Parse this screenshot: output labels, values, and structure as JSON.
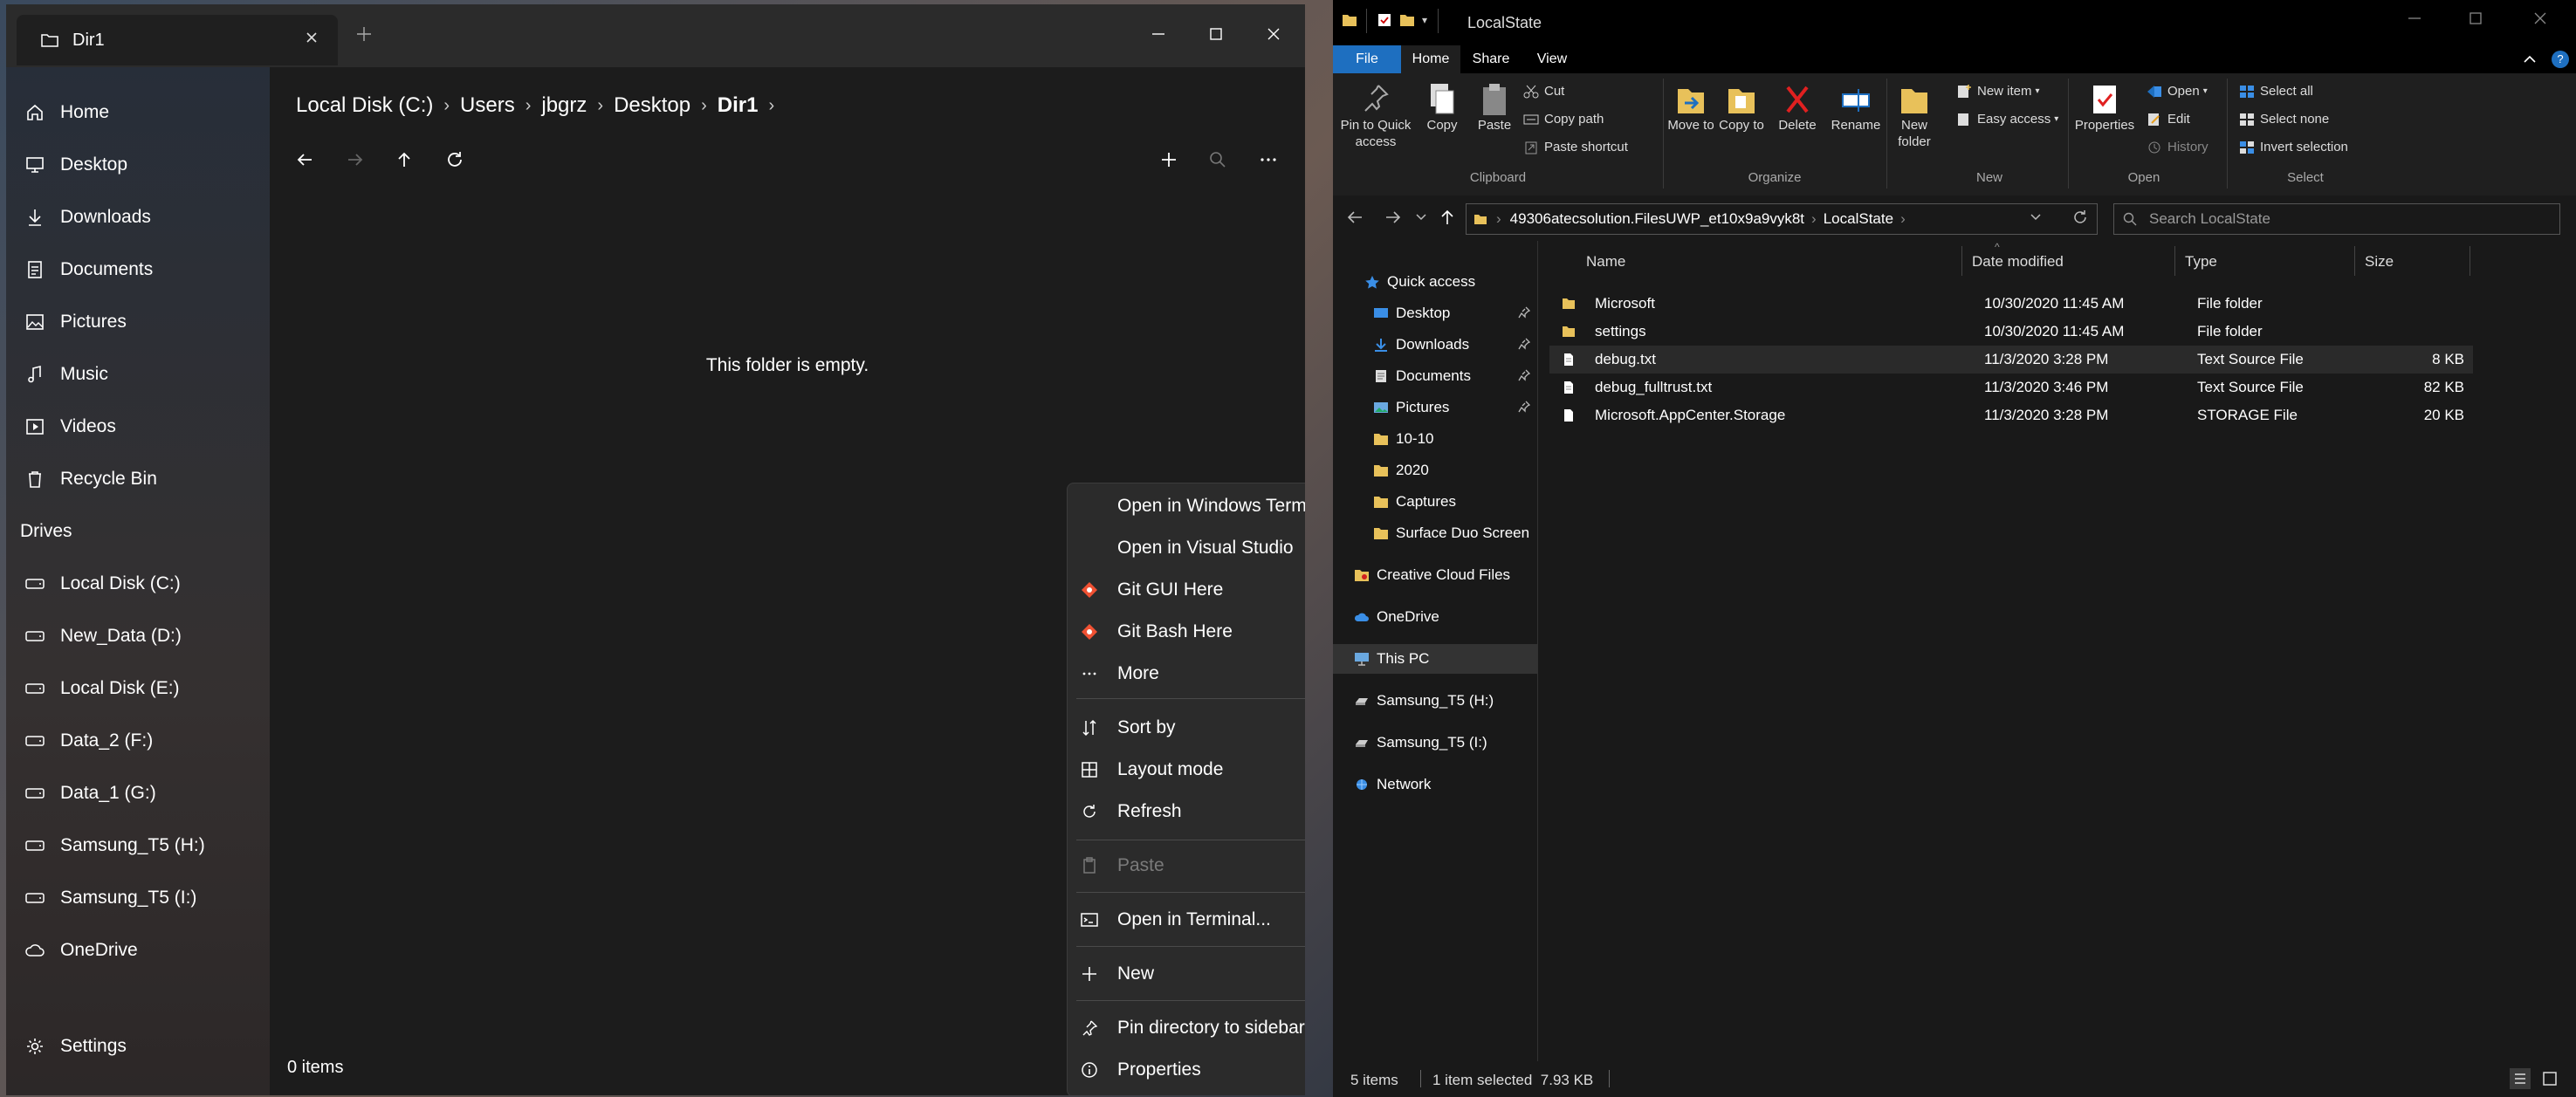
{
  "files_app": {
    "tab_title": "Dir1",
    "sidebar": {
      "items": [
        {
          "label": "Home",
          "icon": "home-icon"
        },
        {
          "label": "Desktop",
          "icon": "desktop-icon"
        },
        {
          "label": "Downloads",
          "icon": "download-icon"
        },
        {
          "label": "Documents",
          "icon": "document-icon"
        },
        {
          "label": "Pictures",
          "icon": "picture-icon"
        },
        {
          "label": "Music",
          "icon": "music-icon"
        },
        {
          "label": "Videos",
          "icon": "video-icon"
        },
        {
          "label": "Recycle Bin",
          "icon": "recycle-bin-icon"
        }
      ],
      "drives_header": "Drives",
      "drives": [
        {
          "label": "Local Disk (C:)"
        },
        {
          "label": "New_Data (D:)"
        },
        {
          "label": "Local Disk (E:)"
        },
        {
          "label": "Data_2 (F:)"
        },
        {
          "label": "Data_1 (G:)"
        },
        {
          "label": "Samsung_T5 (H:)"
        },
        {
          "label": "Samsung_T5 (I:)"
        },
        {
          "label": "OneDrive"
        }
      ],
      "settings": "Settings"
    },
    "breadcrumb": [
      "Local Disk (C:)",
      "Users",
      "jbgrz",
      "Desktop",
      "Dir1"
    ],
    "empty_message": "This folder is empty.",
    "status": "0 items",
    "context_menu": {
      "items": [
        {
          "label": "Open in Windows Terminal"
        },
        {
          "label": "Open in Visual Studio"
        },
        {
          "label": "Git GUI Here",
          "icon": "git-icon"
        },
        {
          "label": "Git Bash Here",
          "icon": "git-icon"
        },
        {
          "label": "More",
          "icon": "more-icon"
        },
        {
          "label": "Sort by",
          "icon": "sort-icon"
        },
        {
          "label": "Layout mode",
          "icon": "layout-icon"
        },
        {
          "label": "Refresh",
          "icon": "refresh-icon"
        },
        {
          "label": "Paste",
          "icon": "paste-icon",
          "disabled": true
        },
        {
          "label": "Open in Terminal...",
          "icon": "terminal-icon"
        },
        {
          "label": "New",
          "icon": "plus-icon"
        },
        {
          "label": "Pin directory to sidebar",
          "icon": "pin-icon"
        },
        {
          "label": "Properties",
          "icon": "info-icon"
        }
      ]
    }
  },
  "explorer": {
    "title": "LocalState",
    "ribbon_tabs": [
      "File",
      "Home",
      "Share",
      "View"
    ],
    "ribbon": {
      "pin_quick_access": "Pin to Quick access",
      "copy": "Copy",
      "paste": "Paste",
      "cut": "Cut",
      "copy_path": "Copy path",
      "paste_shortcut": "Paste shortcut",
      "move_to": "Move to",
      "copy_to": "Copy to",
      "delete": "Delete",
      "rename": "Rename",
      "new_folder": "New folder",
      "new_item": "New item",
      "easy_access": "Easy access",
      "properties": "Properties",
      "open": "Open",
      "edit": "Edit",
      "history": "History",
      "select_all": "Select all",
      "select_none": "Select none",
      "invert_selection": "Invert selection",
      "groups": [
        "Clipboard",
        "Organize",
        "New",
        "Open",
        "Select"
      ]
    },
    "address": [
      "49306atecsolution.FilesUWP_et10x9a9vyk8t",
      "LocalState"
    ],
    "search_placeholder": "Search LocalState",
    "nav": {
      "quick_access": "Quick access",
      "pinned": [
        "Desktop",
        "Downloads",
        "Documents",
        "Pictures"
      ],
      "folders": [
        "10-10",
        "2020",
        "Captures",
        "Surface Duo Screen"
      ],
      "creative_cloud": "Creative Cloud Files",
      "onedrive": "OneDrive",
      "this_pc": "This PC",
      "drives": [
        "Samsung_T5 (H:)",
        "Samsung_T5 (I:)"
      ],
      "network": "Network"
    },
    "columns": [
      "Name",
      "Date modified",
      "Type",
      "Size"
    ],
    "files": [
      {
        "name": "Microsoft",
        "date": "10/30/2020 11:45 AM",
        "type": "File folder",
        "size": "",
        "kind": "folder"
      },
      {
        "name": "settings",
        "date": "10/30/2020 11:45 AM",
        "type": "File folder",
        "size": "",
        "kind": "folder"
      },
      {
        "name": "debug.txt",
        "date": "11/3/2020 3:28 PM",
        "type": "Text Source File",
        "size": "8 KB",
        "kind": "file"
      },
      {
        "name": "debug_fulltrust.txt",
        "date": "11/3/2020 3:46 PM",
        "type": "Text Source File",
        "size": "82 KB",
        "kind": "file"
      },
      {
        "name": "Microsoft.AppCenter.Storage",
        "date": "11/3/2020 3:28 PM",
        "type": "STORAGE File",
        "size": "20 KB",
        "kind": "file"
      }
    ],
    "status": {
      "count": "5 items",
      "selected": "1 item selected  7.93 KB"
    }
  },
  "colors": {
    "accent": "#1e6fc0",
    "folder": "#e8c15a"
  }
}
